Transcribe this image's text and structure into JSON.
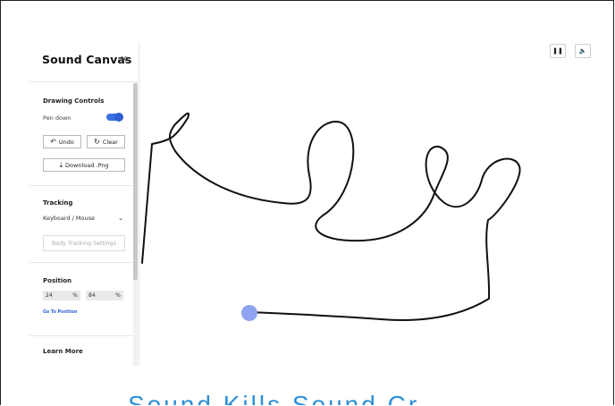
{
  "sidebar": {
    "title": "Sound Canvas",
    "close_icon": "×",
    "drawing": {
      "title": "Drawing Controls",
      "pen_label": "Pen down",
      "pen_down": true,
      "undo_icon": "↶",
      "undo_label": "Undo",
      "clear_icon": "↻",
      "clear_label": "Clear",
      "download_icon": "⤓",
      "download_label": "Download .Png"
    },
    "tracking": {
      "title": "Tracking",
      "selected": "Keyboard / Mouse",
      "chevron_icon": "⌄",
      "body_tracking_label": "Body Tracking Settings"
    },
    "position": {
      "title": "Position",
      "x_value": "24",
      "x_unit": "%",
      "y_value": "84",
      "y_unit": "%",
      "goto_label": "Go To Position"
    },
    "learn_more": "Learn More"
  },
  "controls": {
    "pause_icon": "❚❚",
    "volume_icon": "🔈"
  },
  "colors": {
    "accent": "#3b6fe0",
    "cursor": "#8fa3f0",
    "stroke": "#111111"
  },
  "bottom_title": "Sound Kills Sound Cr"
}
